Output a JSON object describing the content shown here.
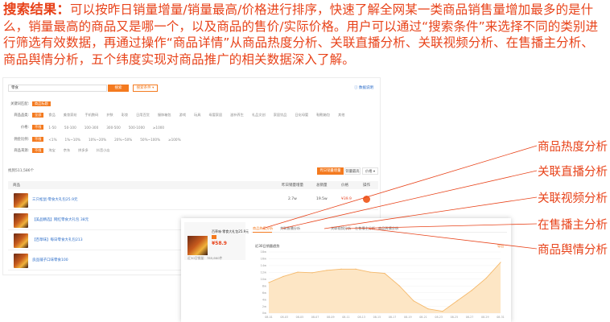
{
  "intro": {
    "heading": "搜索结果：",
    "body": "可以按昨日销量增量/销量最高/价格进行排序，快速了解全网某一类商品销售量增加最多的是什么，销量最高的商品又是哪一个，以及商品的售价/实际价格。用户可以通过“搜索条件”来选择不同的类别进行筛选有效数据，再通过操作“商品详情”从商品热度分析、关联直播分析、关联视频分析、在售播主分析、商品舆情分析，五个纬度实现对商品推广的相关数据深入了解。"
  },
  "search": {
    "value": "零食",
    "button": "搜索",
    "conditions": "搜索条件 ▾",
    "data_link": "ⓘ 数据说明"
  },
  "filters": [
    {
      "label": "关键词匹配:",
      "chip": "商品标题",
      "options": []
    },
    {
      "label": "商品品类:",
      "chip": "全部",
      "options": [
        "食品",
        "美妆家纺",
        "手机数码",
        "护肤",
        "彩妆",
        "日用百货",
        "服饰箱包",
        "游戏",
        "玩具",
        "母婴家居",
        "滋补养生",
        "礼品文创",
        "家居饮品",
        "日化母婴",
        "鞋靴箱包",
        "其他"
      ]
    },
    {
      "label": "价格:",
      "chip": "不限",
      "options": [
        "1-50",
        "50-100",
        "100-300",
        "300-500",
        "500-1000",
        "≥1000"
      ]
    },
    {
      "label": "佣金比例:",
      "chip": "不限",
      "options": [
        "<1%",
        "1%~10%",
        "10%~20%",
        "20%~50%",
        "50%~100%",
        "≥100%"
      ]
    },
    {
      "label": "商品来源:",
      "chip": "不限",
      "options": [
        "淘宝",
        "京东",
        "拼多多",
        "抖音小店"
      ]
    }
  ],
  "results": {
    "count": "找到511,586个",
    "sort_active": "昨日销量增量",
    "sort_plain": "销量最高",
    "sort_select": "价格 ▾",
    "headers": {
      "product": "商品",
      "yesterday": "昨日销量增量",
      "total": "总销量",
      "price": "价格",
      "action": "操作"
    },
    "rows": [
      {
        "title": "三只松鼠·零食大礼包25.9元",
        "yesterday": "2.7w",
        "total": "19.5w",
        "price": "¥39.9"
      },
      {
        "title": "【美品精选】网红零食大礼包 38元",
        "yesterday": "",
        "total": "",
        "price": ""
      },
      {
        "title": "【百草味】每日零食大礼包213",
        "yesterday": "",
        "total": "",
        "price": ""
      },
      {
        "title": "良品铺子口味零食100",
        "yesterday": "",
        "total": "",
        "price": ""
      }
    ]
  },
  "detail": {
    "card": {
      "title": "百草味·零食大礼包25.9元",
      "price": "¥58.9",
      "footer": "近30日销量：789,660件"
    },
    "tabs": [
      "商品热度分析",
      "关联直播分析",
      "关联视频分析",
      "在售播主分析",
      "商品舆情分析"
    ],
    "chart_title": "近30日销量趋势",
    "chart_link": "导出"
  },
  "chart_data": {
    "type": "area",
    "title": "",
    "x": [
      "08-01",
      "08-03",
      "08-05",
      "08-07",
      "08-09",
      "08-11",
      "08-13",
      "08-15",
      "08-17",
      "08-19",
      "08-21",
      "08-23",
      "08-25",
      "08-27",
      "08-29",
      "08-31"
    ],
    "values": [
      50,
      60,
      67,
      66,
      70,
      72,
      72,
      67,
      65,
      45,
      20,
      7,
      3,
      20,
      37,
      57,
      83
    ],
    "ylim": [
      0,
      100
    ],
    "y_ticks": [
      "0w",
      "2w",
      "4w",
      "6w",
      "8w",
      "10w",
      "12w",
      "14w",
      "16w",
      "18w"
    ],
    "color": "#f5b96b",
    "fill": "#fde6c5"
  },
  "annotations": [
    "商品热度分析",
    "关联直播分析",
    "关联视频分析",
    "在售播主分析",
    "商品舆情分析"
  ],
  "colors": {
    "accent": "#f47a1f",
    "annotation": "#e8431a",
    "link": "#2d6ec9"
  }
}
